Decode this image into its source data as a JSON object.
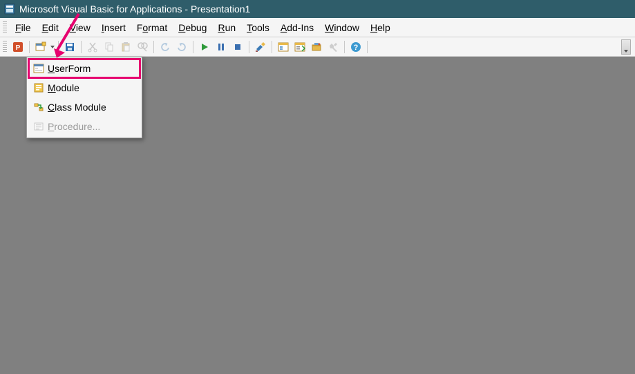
{
  "title": "Microsoft Visual Basic for Applications - Presentation1",
  "menubar": {
    "file": {
      "label": "File",
      "ukey": "F"
    },
    "edit": {
      "label": "Edit",
      "ukey": "E"
    },
    "view": {
      "label": "View",
      "ukey": "V"
    },
    "insert": {
      "label": "Insert",
      "ukey": "I"
    },
    "format": {
      "label": "Format",
      "ukey": "o"
    },
    "debug": {
      "label": "Debug",
      "ukey": "D"
    },
    "run": {
      "label": "Run",
      "ukey": "R"
    },
    "tools": {
      "label": "Tools",
      "ukey": "T"
    },
    "addins": {
      "label": "Add-Ins",
      "ukey": "A"
    },
    "window": {
      "label": "Window",
      "ukey": "W"
    },
    "help": {
      "label": "Help",
      "ukey": "H"
    }
  },
  "toolbar": {
    "view_ppt": "View Microsoft PowerPoint",
    "insert": "Insert",
    "save": "Save",
    "cut": "Cut",
    "copy": "Copy",
    "paste": "Paste",
    "find": "Find",
    "undo": "Undo",
    "redo": "Redo",
    "run": "Run Sub/UserForm",
    "break": "Break",
    "reset": "Reset",
    "design": "Design Mode",
    "explorer": "Project Explorer",
    "properties": "Properties Window",
    "browser": "Object Browser",
    "toolbox": "Toolbox",
    "help": "Help"
  },
  "insert_menu": {
    "userform": {
      "label": "UserForm",
      "ukey": "U"
    },
    "module": {
      "label": "Module",
      "ukey": "M"
    },
    "classmodule": {
      "label": "Class Module",
      "ukey": "C"
    },
    "procedure": {
      "label": "Procedure...",
      "ukey": "P"
    }
  },
  "colors": {
    "highlight": "#e6006e",
    "titlebar": "#2f5d6a",
    "client": "#808080"
  }
}
